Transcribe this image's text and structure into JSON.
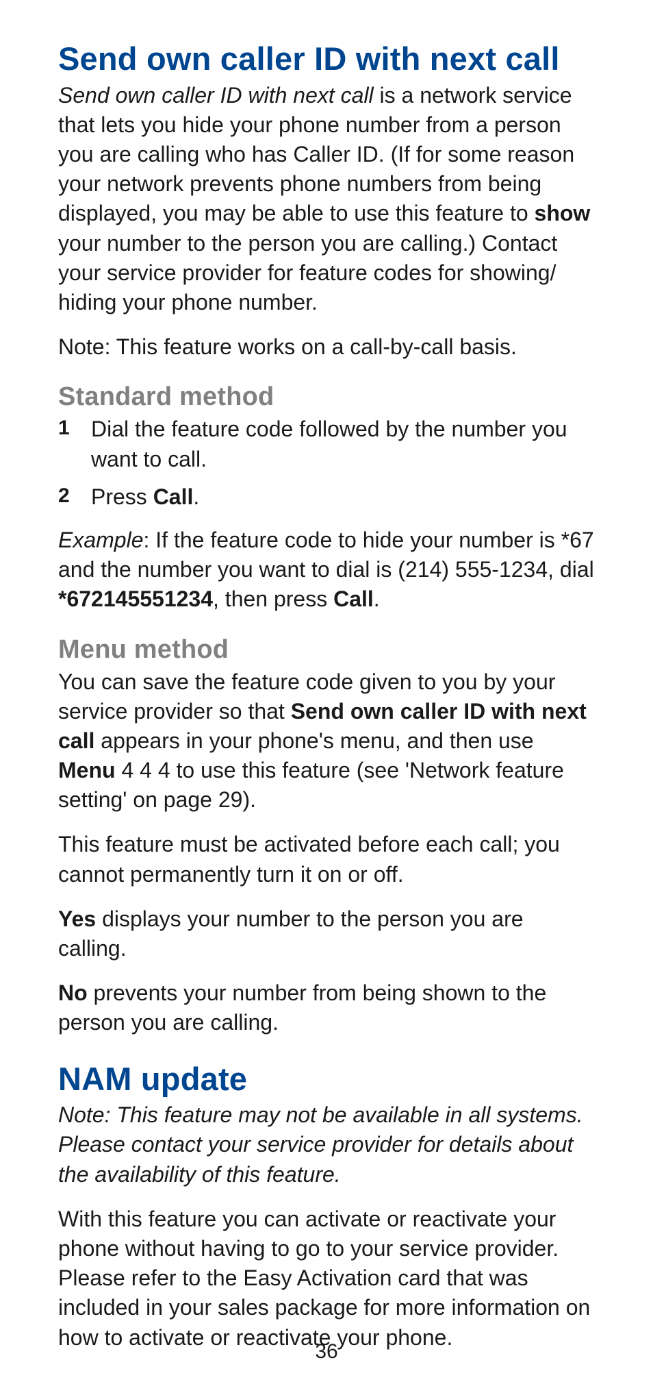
{
  "section1": {
    "title": "Send own caller ID with next call",
    "intro_italic": "Send own caller ID with next call",
    "intro_rest_a": " is a network service that lets you hide your phone number from a person you are calling who has Caller ID. (If for some reason your network prevents phone numbers from being displayed, you may be able to use this feature to ",
    "intro_bold": "show",
    "intro_rest_b": " your number to the person you are calling.) Contact your service provider for feature codes for showing/ hiding your phone number.",
    "note": "Note: This feature works on a call-by-call basis."
  },
  "standard": {
    "heading": "Standard method",
    "step1_num": "1",
    "step1": "Dial the feature code followed by the number you want to call.",
    "step2_num": "2",
    "step2_a": "Press ",
    "step2_bold": "Call",
    "step2_b": ".",
    "example_label": "Example",
    "example_a": ":  If the feature code to hide your number is *67 and the number you want to dial is (214) 555-1234, dial ",
    "example_bold1": "*672145551234",
    "example_mid": ", then press ",
    "example_bold2": "Call",
    "example_end": "."
  },
  "menu": {
    "heading": "Menu method",
    "p1_a": "You can save the feature code given to you by your service provider so that ",
    "p1_bold1": "Send own caller ID with next call",
    "p1_b": " appears in your phone's menu, and then use ",
    "p1_bold2": "Menu",
    "p1_c": " 4 4 4 to use this feature (see 'Network feature setting' on page 29).",
    "p2": "This feature must be activated before each call; you cannot permanently turn it on or off.",
    "p3_bold": "Yes",
    "p3_rest": " displays your number to the person you are calling.",
    "p4_bold": "No",
    "p4_rest": " prevents your number from being shown to the person you are calling."
  },
  "section2": {
    "title": "NAM update",
    "note_italic": "Note:  This feature may not be available in all systems. Please contact your service provider for details about the availability of this feature.",
    "body": "With this feature you can activate or reactivate your phone without having to go to your service provider. Please refer to the Easy Activation card that was included in your sales package for more information on how to activate or reactivate your phone."
  },
  "pagenum": "36"
}
